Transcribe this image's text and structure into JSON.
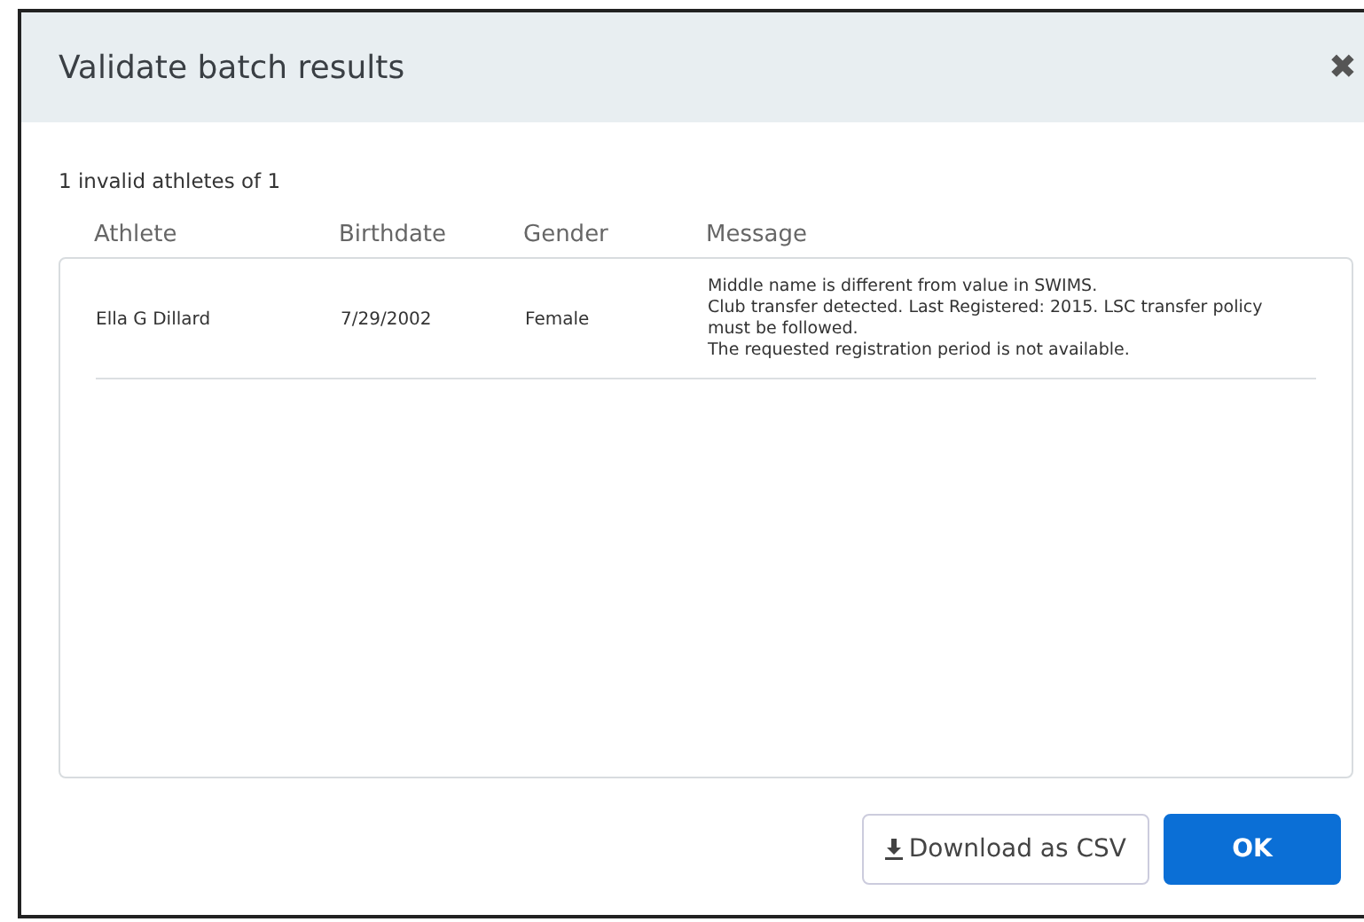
{
  "dialog": {
    "title": "Validate batch results",
    "close": "✖"
  },
  "summary": "1 invalid athletes of 1",
  "table": {
    "columns": [
      "Athlete",
      "Birthdate",
      "Gender",
      "Message"
    ],
    "rows": [
      {
        "athlete": "Ella G Dillard",
        "birthdate": "7/29/2002",
        "gender": "Female",
        "messages": [
          "Middle name is different from value in SWIMS.",
          "Club transfer detected. Last Registered: 2015. LSC transfer policy must be followed.",
          "The requested registration period is not available."
        ]
      }
    ]
  },
  "buttons": [
    {
      "label": "Download as CSV",
      "kind": "download"
    },
    {
      "label": "OK",
      "kind": "primary"
    }
  ]
}
